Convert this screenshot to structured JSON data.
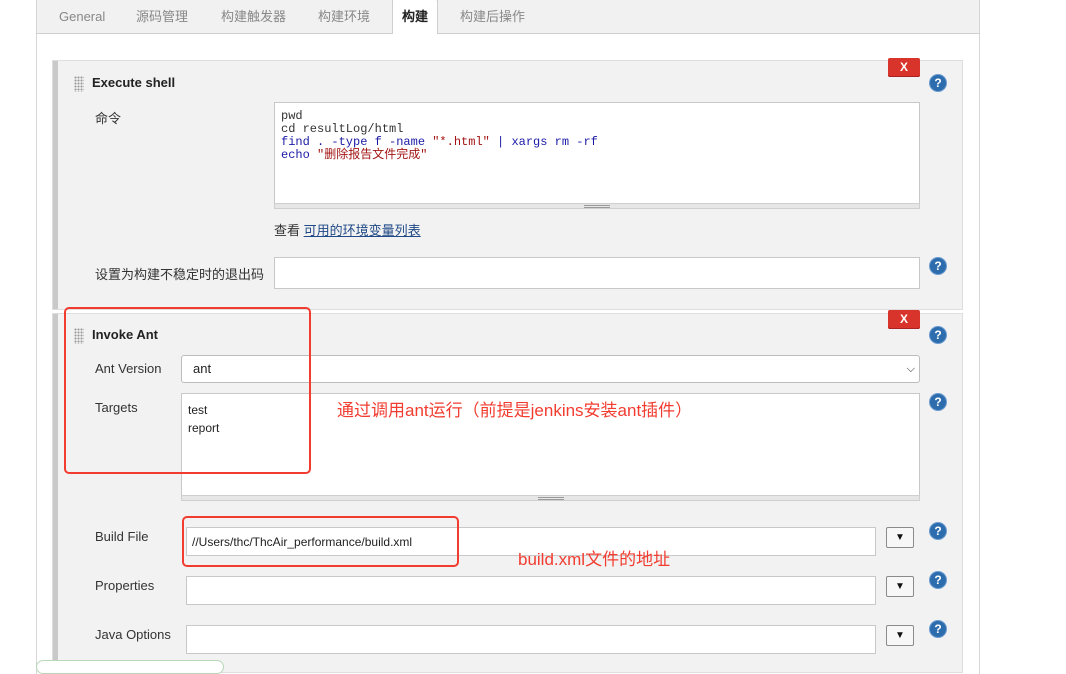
{
  "tabs": [
    {
      "label": "General",
      "active": false
    },
    {
      "label": "源码管理",
      "active": false
    },
    {
      "label": "构建触发器",
      "active": false
    },
    {
      "label": "构建环境",
      "active": false
    },
    {
      "label": "构建",
      "active": true
    },
    {
      "label": "构建后操作",
      "active": false
    }
  ],
  "shell_step": {
    "title": "Execute shell",
    "delete_label": "X",
    "help_icon": "?",
    "command_label": "命令",
    "command_lines": [
      "pwd",
      "cd resultLog/html",
      "find . -type f -name \"*.html\" | xargs rm -rf",
      "echo \"删除报告文件完成\""
    ],
    "env_prefix": "查看",
    "env_link": "可用的环境变量列表",
    "exit_code_label": "设置为构建不稳定时的退出码",
    "exit_code_value": ""
  },
  "ant_step": {
    "title": "Invoke Ant",
    "delete_label": "X",
    "help_icon": "?",
    "version_label": "Ant Version",
    "version_value": "ant",
    "targets_label": "Targets",
    "targets_value": "test\nreport",
    "build_file_label": "Build File",
    "build_file_value": "//Users/thc/ThcAir_performance/build.xml",
    "properties_label": "Properties",
    "properties_value": "",
    "java_options_label": "Java Options",
    "java_options_value": "",
    "dropdown_glyph": "▼"
  },
  "annotations": {
    "ant_note": "通过调用ant运行（前提是jenkins安装ant插件）",
    "build_file_note": "build.xml文件的地址"
  },
  "colors": {
    "annotation_red": "#f23c30",
    "delete_red": "#d9342b",
    "help_blue": "#2e6dad",
    "link_blue": "#204a87"
  }
}
